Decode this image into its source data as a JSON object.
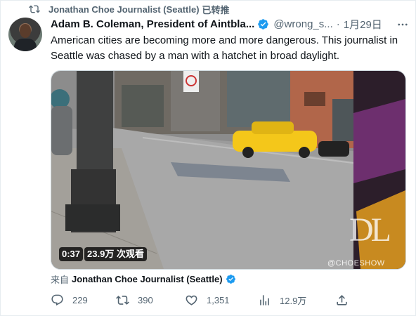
{
  "repost": {
    "reposter": "Jonathan Choe Journalist (Seattle)",
    "label": "已转推",
    "icon": "repost-icon"
  },
  "tweet": {
    "author_name": "Adam B. Coleman, President of Aintbla...",
    "verified_icon": "verified-badge-icon",
    "handle": "@wrong_s...",
    "separator": "·",
    "time": "1月29日",
    "text": "American cities are becoming more and more dangerous. This journalist in Seattle was chased by a man with a hatchet in broad daylight.",
    "more_icon": "more-icon"
  },
  "media": {
    "duration": "0:37",
    "views": "23.9万 次观看",
    "watermark": "DL",
    "watermark_sub": "@CHOESHOW"
  },
  "source": {
    "prefix": "来自",
    "name": "Jonathan Choe Journalist (Seattle)"
  },
  "actions": {
    "reply_count": "229",
    "repost_count": "390",
    "like_count": "1,351",
    "views_count": "12.9万"
  },
  "colors": {
    "accent": "#1d9bf0",
    "secondary_text": "#536471",
    "primary_text": "#0f1419",
    "taxi_yellow": "#f4c71a"
  }
}
